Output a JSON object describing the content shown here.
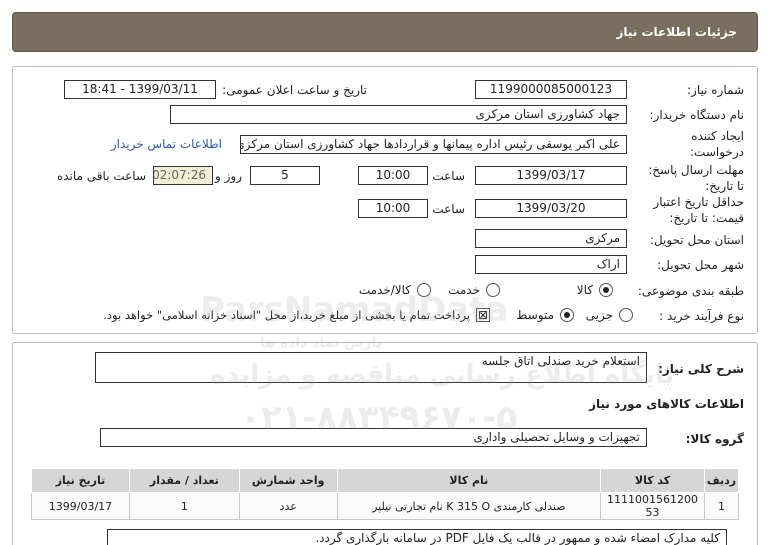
{
  "header": {
    "title": "جزئیات اطلاعات نیاز"
  },
  "fields": {
    "need_number_label": "شماره نیاز:",
    "need_number": "1199000085000123",
    "announce_label": "تاریخ و ساعت اعلان عمومی:",
    "announce_value": "1399/03/11 - 18:41",
    "buyer_label": "نام دستگاه خریدار:",
    "buyer_value": "جهاد کشاورزی استان مرکزی",
    "creator_label_1": "ایجاد کننده",
    "creator_label_2": "درخواست:",
    "creator_value": "علی اکبر یوسفی رئیس اداره پیمانها و قراردادها جهاد کشاورزی استان مرکزی",
    "contact_link": "اطلاعات تماس خریدار",
    "deadline_label_1": "مهلت ارسال پاسخ:",
    "deadline_label_2": "تا تاریخ:",
    "deadline_date": "1399/03/17",
    "time_label": "ساعت",
    "deadline_time": "10:00",
    "days_value": "5",
    "days_label": "روز و",
    "remaining_timer": "02:07:26",
    "remaining_label": "ساعت باقی مانده",
    "validity_label_1": "حداقل تاریخ اعتبار",
    "validity_label_2": "قیمت: تا تاریخ:",
    "validity_date": "1399/03/20",
    "validity_time": "10:00",
    "province_label": "استان محل تحویل:",
    "province_value": "مرکزی",
    "city_label": "شهر محل تحویل:",
    "city_value": "اراک",
    "category_label": "طبقه بندی موضوعی:",
    "category_options": [
      "کالا",
      "خدمت",
      "کالا/خدمت"
    ],
    "purchase_label": "نوع فرآیند خرید :",
    "purchase_options": [
      "جزیی",
      "متوسط"
    ],
    "payment_note": "پرداخت تمام یا بخشی از مبلغ خرید،از محل \"اسناد خزانه اسلامی\" خواهد بود."
  },
  "summary": {
    "description_label": "شرح کلی نیاز:",
    "description_value": "استعلام خرید صندلی اتاق جلسه",
    "goods_title": "اطلاعات کالاهای مورد نیاز",
    "group_label": "گروه کالا:",
    "group_value": "تجهیزات و وسایل تحصیلی واداری"
  },
  "table": {
    "headers": [
      "ردیف",
      "کد کالا",
      "نام کالا",
      "واحد شمارش",
      "تعداد / مقدار",
      "تاریخ نیاز"
    ],
    "rows": [
      [
        "1",
        "1111001561200 53",
        "صندلی کارمندی K 315 O نام تجارتی نیلپر",
        "عدد",
        "1",
        "1399/03/17"
      ]
    ]
  },
  "note": "کلیه مدارک امضاء شده و ممهور در قالب یک فایل PDF  در سامانه بارگذاری گردد.",
  "watermark": {
    "brand": "ParsNamadData",
    "line1": "پایگاه اطلاع رسانی مناقصه و مزایده",
    "line2": "۰۲۱-۸۸۳۴۹۶۷۰-۵",
    "line3": "پارس نماد داده ها"
  }
}
